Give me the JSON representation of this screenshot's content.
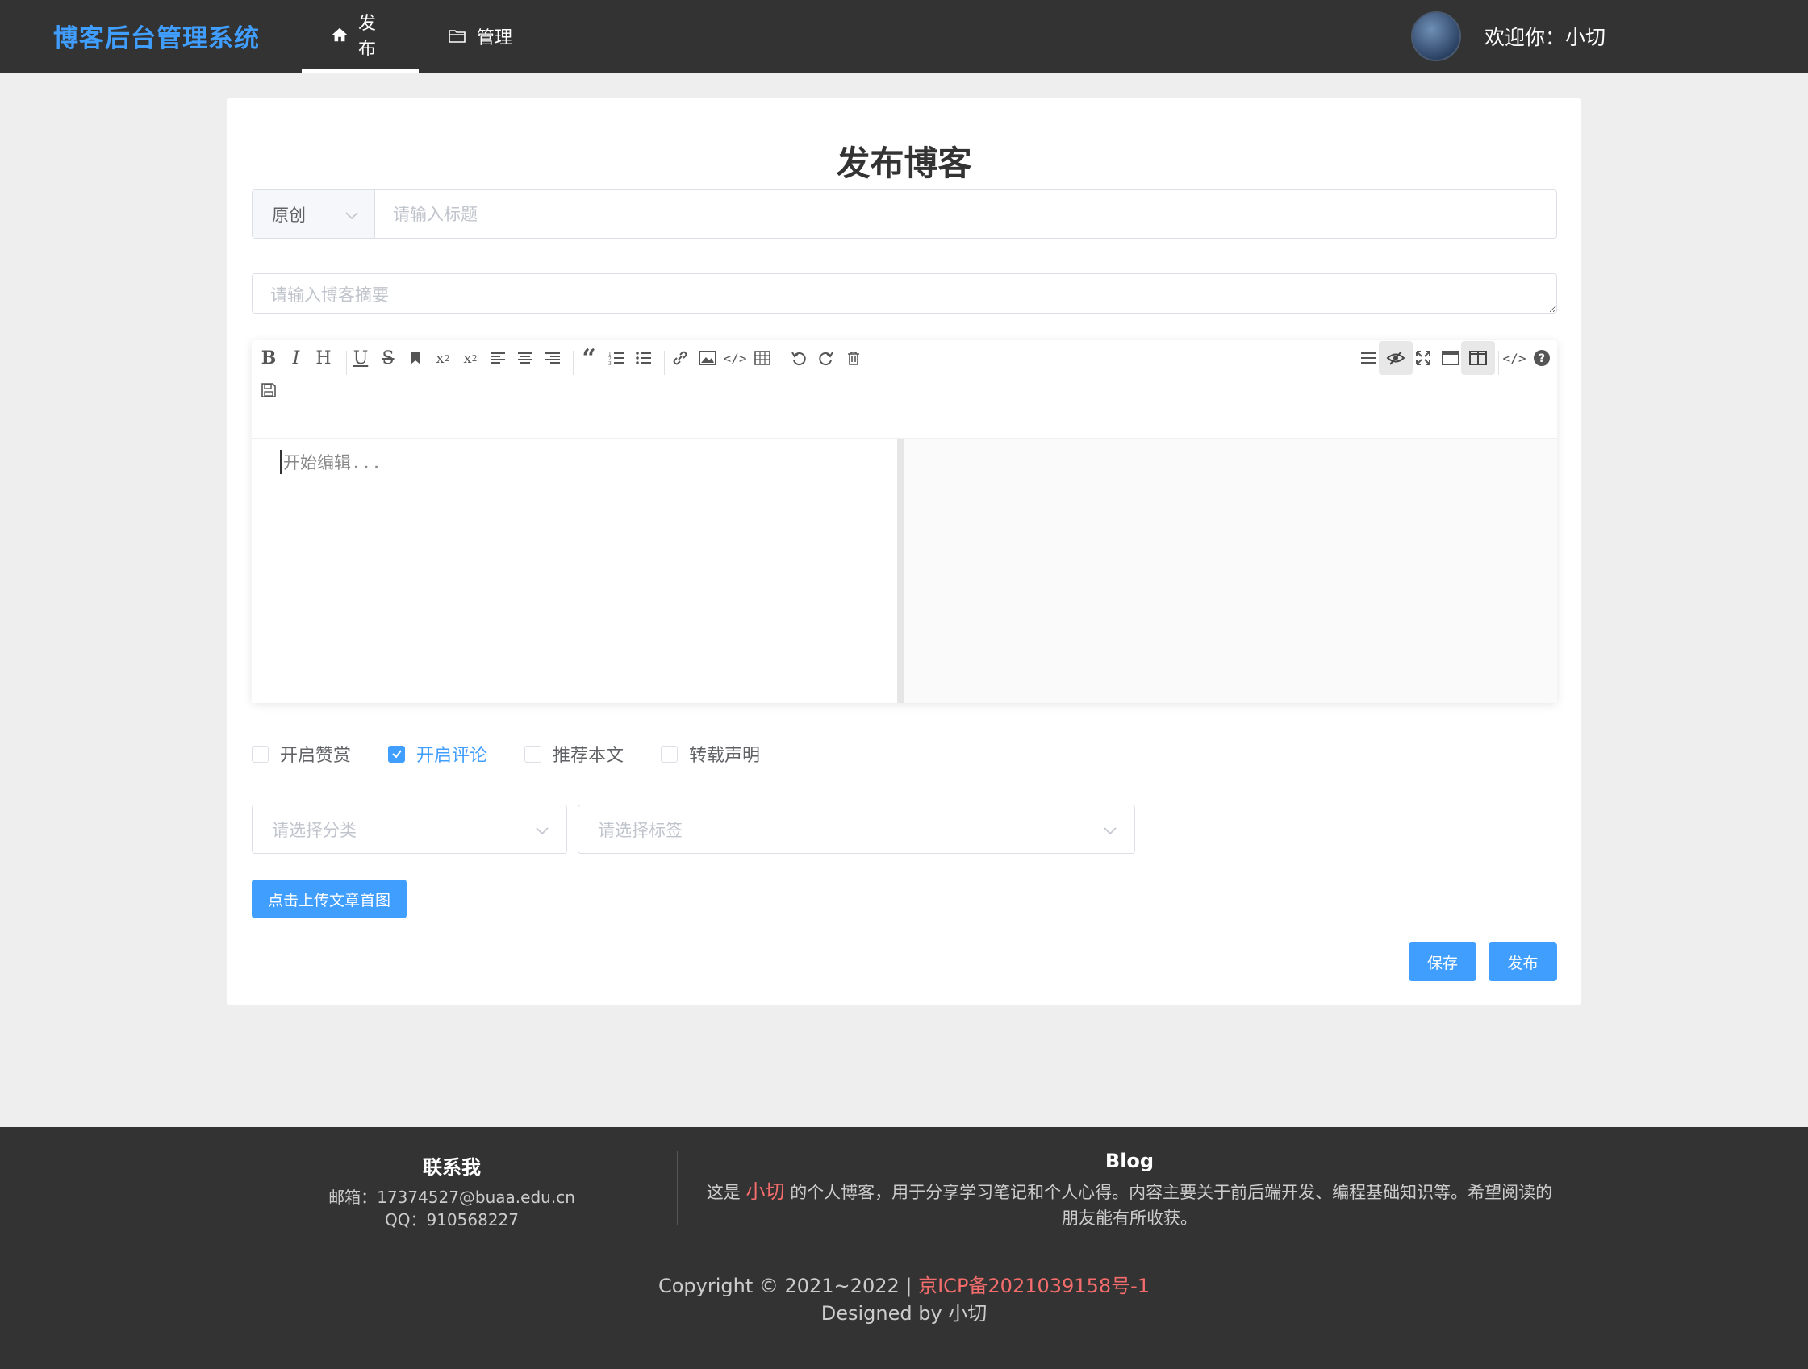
{
  "header": {
    "brand": "博客后台管理系统",
    "nav": [
      {
        "label": "发布",
        "icon": "home-icon",
        "active": true
      },
      {
        "label": "管理",
        "icon": "folder-icon",
        "active": false
      }
    ],
    "welcome": "欢迎你：小切"
  },
  "page": {
    "title": "发布博客",
    "type_select": "原创",
    "title_placeholder": "请输入标题",
    "summary_placeholder": "请输入博客摘要",
    "editor_placeholder": "开始编辑...",
    "checkboxes": [
      {
        "label": "开启赞赏",
        "checked": false
      },
      {
        "label": "开启评论",
        "checked": true
      },
      {
        "label": "推荐本文",
        "checked": false
      },
      {
        "label": "转载声明",
        "checked": false
      }
    ],
    "category_placeholder": "请选择分类",
    "tag_placeholder": "请选择标签",
    "upload_button": "点击上传文章首图",
    "save_button": "保存",
    "publish_button": "发布"
  },
  "toolbar": {
    "left_buttons": [
      "bold-icon",
      "italic-icon",
      "header-icon",
      "underline-icon",
      "strikethrough-icon",
      "mark-icon",
      "superscript-icon",
      "subscript-icon",
      "align-left-icon",
      "align-center-icon",
      "align-right-icon",
      "quote-icon",
      "ordered-list-icon",
      "unordered-list-icon",
      "link-icon",
      "image-icon",
      "code-icon",
      "table-icon",
      "undo-icon",
      "redo-icon",
      "trash-icon",
      "save-icon"
    ],
    "right_buttons": [
      "navigation-icon",
      "preview-icon",
      "fullscreen-icon",
      "read-mode-icon",
      "split-view-icon",
      "html-code-icon",
      "help-icon"
    ]
  },
  "footer": {
    "contact_title": "联系我",
    "email": "邮箱：17374527@buaa.edu.cn",
    "qq": "QQ：910568227",
    "blog_title": "Blog",
    "desc_pre": "这是",
    "desc_name": "小切",
    "desc_post": "的个人博客，用于分享学习笔记和个人心得。内容主要关于前后端开发、编程基础知识等。希望阅读的朋友能有所收获。",
    "copyright": "Copyright © 2021~2022 |",
    "icp": "京ICP备2021039158号-1",
    "designed": "Designed by 小切"
  },
  "colors": {
    "accent": "#409eff",
    "topbar": "#333333",
    "footer": "#333333",
    "highlight": "#f56c6c"
  }
}
